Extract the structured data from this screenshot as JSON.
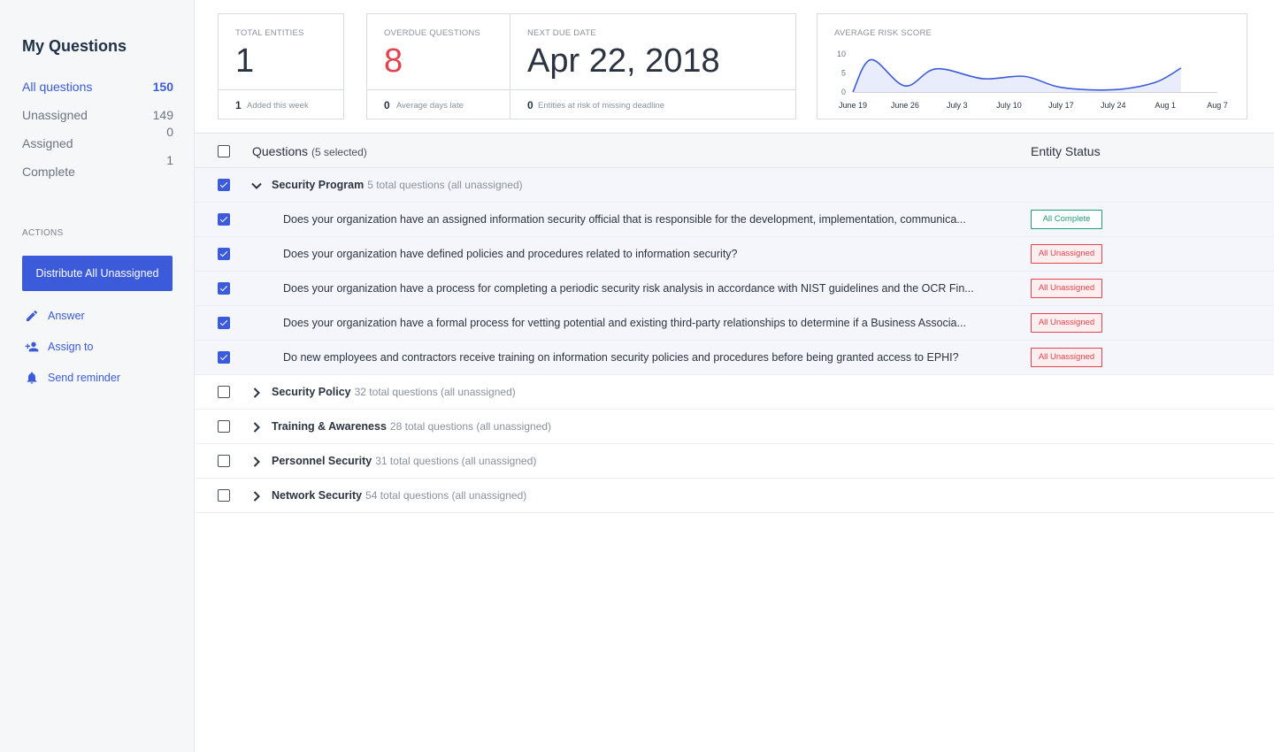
{
  "sidebar": {
    "title": "My Questions",
    "nav": [
      {
        "label": "All questions",
        "count": "150"
      },
      {
        "label": "Unassigned",
        "count": "149"
      },
      {
        "label": "Assigned",
        "count": "0"
      },
      {
        "label": "Complete",
        "count": "1"
      }
    ],
    "actions_heading": "ACTIONS",
    "distribute_label": "Distribute All Unassigned",
    "actions": [
      {
        "label": "Answer",
        "icon": "pencil-icon"
      },
      {
        "label": "Assign to",
        "icon": "add-person-icon"
      },
      {
        "label": "Send reminder",
        "icon": "bell-icon"
      }
    ]
  },
  "stats": {
    "total_entities": {
      "label": "TOTAL ENTITIES",
      "value": "1",
      "foot_value": "1",
      "foot_text": "Added this week"
    },
    "overdue": {
      "label": "OVERDUE QUESTIONS",
      "value": "8",
      "foot_value": "0",
      "foot_text": "Average days late",
      "value_color": "#e2444f"
    },
    "next_due": {
      "label": "NEXT DUE DATE",
      "value": "Apr 22, 2018",
      "foot_value": "0",
      "foot_text": "Entities at risk of missing deadline"
    },
    "risk": {
      "label": "AVERAGE RISK SCORE"
    }
  },
  "chart_data": {
    "type": "area",
    "x": [
      "June 19",
      "June 26",
      "July 3",
      "July 10",
      "July 17",
      "July 24",
      "Aug 1",
      "Aug 7"
    ],
    "yticks": [
      0,
      5,
      10
    ],
    "ylim": [
      0,
      10
    ],
    "points": [
      [
        0,
        0
      ],
      [
        0.35,
        8.5
      ],
      [
        1,
        1.6
      ],
      [
        1.6,
        6.1
      ],
      [
        2.5,
        3.5
      ],
      [
        3.3,
        4.1
      ],
      [
        4.0,
        1.2
      ],
      [
        5.0,
        0.6
      ],
      [
        5.8,
        2.5
      ],
      [
        6.3,
        6.3
      ]
    ],
    "line_color": "#3b5bdb",
    "fill_color": "#e9edfb"
  },
  "table": {
    "header_label": "Questions",
    "header_selected": "(5 selected)",
    "status_header": "Entity Status",
    "groups": [
      {
        "name": "Security Program",
        "meta": "5 total questions (all unassigned)",
        "expanded": true,
        "checked": true,
        "questions": [
          {
            "text": "Does your organization have an assigned information security official that is responsible for the development, implementation, communica...",
            "status": "All Complete",
            "status_type": "ok"
          },
          {
            "text": "Does your organization have defined policies and procedures related to information security?",
            "status": "All Unassigned",
            "status_type": "bad"
          },
          {
            "text": "Does your organization have a process for completing a periodic security risk analysis in accordance with NIST guidelines and the OCR Fin...",
            "status": "All Unassigned",
            "status_type": "bad"
          },
          {
            "text": "Does your organization have a formal process for vetting potential and existing third-party relationships to determine if a Business Associa...",
            "status": "All Unassigned",
            "status_type": "bad"
          },
          {
            "text": "Do new employees and contractors receive training on information security policies and procedures before being granted access to EPHI?",
            "status": "All Unassigned",
            "status_type": "bad"
          }
        ]
      },
      {
        "name": "Security Policy",
        "meta": "32 total questions (all unassigned)",
        "expanded": false,
        "checked": false
      },
      {
        "name": "Training & Awareness",
        "meta": "28 total questions (all unassigned)",
        "expanded": false,
        "checked": false
      },
      {
        "name": "Personnel Security",
        "meta": "31 total questions (all unassigned)",
        "expanded": false,
        "checked": false
      },
      {
        "name": "Network Security",
        "meta": "54 total questions (all unassigned)",
        "expanded": false,
        "checked": false
      }
    ]
  }
}
